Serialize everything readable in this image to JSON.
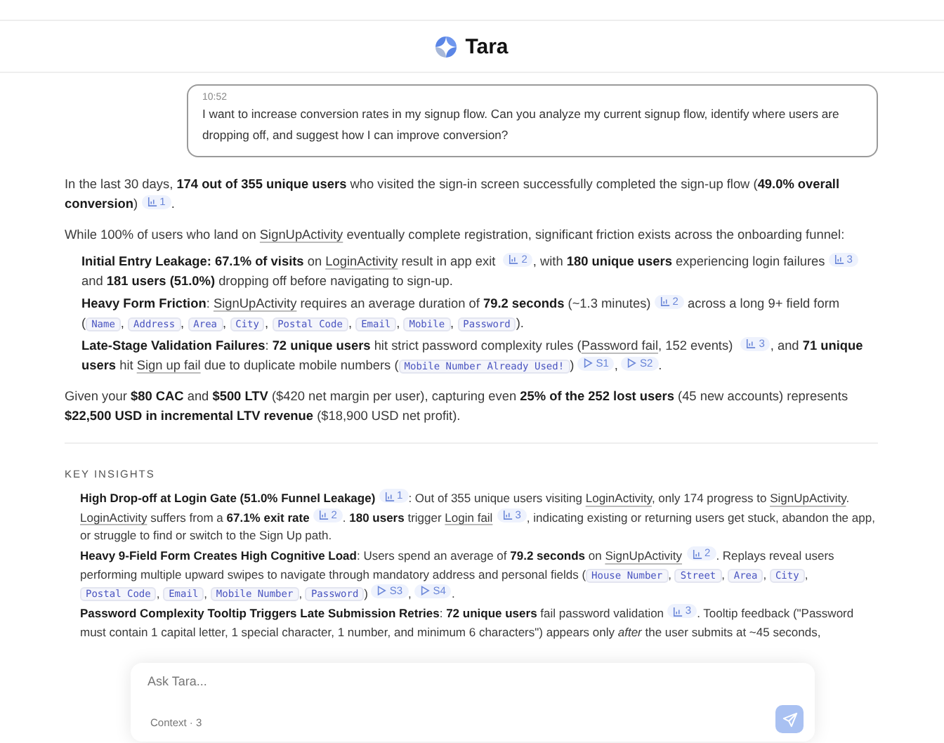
{
  "header": {
    "title": "Tara"
  },
  "user_message": {
    "time": "10:52",
    "text": "I want to increase conversion rates in my signup flow. Can you analyze my current signup flow, identify where users are dropping off, and suggest how I can improve conversion?"
  },
  "response": {
    "blocks": [
      {
        "kind": "paragraph",
        "segments": [
          {
            "kind": "text",
            "text": "In the last 30 days, **174 out of 355 unique users** who visited the sign-in screen successfully completed the sign-up flow (**49.0% overall conversion**) "
          },
          {
            "kind": "chart",
            "text": "1"
          },
          {
            "kind": "text",
            "text": "."
          }
        ]
      },
      {
        "kind": "paragraph",
        "segments": [
          {
            "kind": "text",
            "text": "While 100% of users who land on "
          },
          {
            "kind": "link",
            "text": "SignUpActivity"
          },
          {
            "kind": "text",
            "text": " eventually complete registration, significant friction exists across the onboarding funnel:"
          }
        ]
      },
      {
        "kind": "bullet",
        "segments": [
          {
            "kind": "text",
            "text": "**Initial Entry Leakage: 67.1% of visits** on "
          },
          {
            "kind": "link",
            "text": "LoginActivity"
          },
          {
            "kind": "text",
            "text": " result in app exit "
          },
          {
            "kind": "chart",
            "text": "2"
          },
          {
            "kind": "text",
            "text": ", with **180 unique users** experiencing login failures "
          },
          {
            "kind": "chart",
            "text": "3"
          },
          {
            "kind": "text",
            "text": " and **181 users (51.0%)** dropping off before navigating to sign-up."
          }
        ]
      },
      {
        "kind": "bullet",
        "segments": [
          {
            "kind": "text",
            "text": "**Heavy Form Friction**: "
          },
          {
            "kind": "link",
            "text": "SignUpActivity"
          },
          {
            "kind": "text",
            "text": " requires an average duration of **79.2 seconds** (~1.3 minutes) "
          },
          {
            "kind": "chart",
            "text": "2"
          },
          {
            "kind": "text",
            "text": " across a long 9+ field form ("
          },
          {
            "kind": "code",
            "text": "Name"
          },
          {
            "kind": "text",
            "text": ", "
          },
          {
            "kind": "code",
            "text": "Address"
          },
          {
            "kind": "text",
            "text": ", "
          },
          {
            "kind": "code",
            "text": "Area"
          },
          {
            "kind": "text",
            "text": ", "
          },
          {
            "kind": "code",
            "text": "City"
          },
          {
            "kind": "text",
            "text": ", "
          },
          {
            "kind": "code",
            "text": "Postal Code"
          },
          {
            "kind": "text",
            "text": ", "
          },
          {
            "kind": "code",
            "text": "Email"
          },
          {
            "kind": "text",
            "text": ", "
          },
          {
            "kind": "code",
            "text": "Mobile"
          },
          {
            "kind": "text",
            "text": ", "
          },
          {
            "kind": "code",
            "text": "Password"
          },
          {
            "kind": "text",
            "text": ")."
          }
        ]
      },
      {
        "kind": "bullet",
        "segments": [
          {
            "kind": "text",
            "text": "**Late-Stage Validation Failures**: **72 unique users** hit strict password complexity rules ("
          },
          {
            "kind": "link",
            "text": "Password fail"
          },
          {
            "kind": "text",
            "text": ", 152 events) "
          },
          {
            "kind": "chart",
            "text": "3"
          },
          {
            "kind": "text",
            "text": ", and **71 unique users** hit "
          },
          {
            "kind": "link",
            "text": "Sign up fail"
          },
          {
            "kind": "text",
            "text": " due to duplicate mobile numbers ("
          },
          {
            "kind": "code",
            "text": "Mobile Number Already Used!"
          },
          {
            "kind": "text",
            "text": ") "
          },
          {
            "kind": "session",
            "text": "S1"
          },
          {
            "kind": "text",
            "text": ", "
          },
          {
            "kind": "session",
            "text": "S2"
          },
          {
            "kind": "text",
            "text": "."
          }
        ]
      },
      {
        "kind": "paragraph",
        "segments": [
          {
            "kind": "text",
            "text": "Given your **$80 CAC** and **$500 LTV** ($420 net margin per user), capturing even **25% of the 252 lost users** (45 new accounts) represents **$22,500 USD in incremental LTV revenue** ($18,900 USD net profit)."
          }
        ]
      }
    ],
    "insights_heading": "KEY INSIGHTS",
    "insights": [
      {
        "segments": [
          {
            "kind": "text",
            "text": "**High Drop-off at Login Gate (51.0% Funnel Leakage)** "
          },
          {
            "kind": "chart",
            "text": "1"
          },
          {
            "kind": "text",
            "text": ": Out of 355 unique users visiting "
          },
          {
            "kind": "link",
            "text": "LoginActivity"
          },
          {
            "kind": "text",
            "text": ", only 174 progress to "
          },
          {
            "kind": "link",
            "text": "SignUpActivity"
          },
          {
            "kind": "text",
            "text": ". "
          },
          {
            "kind": "link",
            "text": "LoginActivity"
          },
          {
            "kind": "text",
            "text": " suffers from a **67.1% exit rate** "
          },
          {
            "kind": "chart",
            "text": "2"
          },
          {
            "kind": "text",
            "text": ". **180 users** trigger "
          },
          {
            "kind": "link",
            "text": "Login fail"
          },
          {
            "kind": "chart",
            "text": "3"
          },
          {
            "kind": "text",
            "text": ", indicating existing or returning users get stuck, abandon the app, or struggle to find or switch to the Sign Up path."
          }
        ]
      },
      {
        "segments": [
          {
            "kind": "text",
            "text": "**Heavy 9-Field Form Creates High Cognitive Load**: Users spend an average of **79.2 seconds** on "
          },
          {
            "kind": "link",
            "text": "SignUpActivity"
          },
          {
            "kind": "chart",
            "text": "2"
          },
          {
            "kind": "text",
            "text": ". Replays reveal users performing multiple upward swipes to navigate through mandatory address and personal fields ("
          },
          {
            "kind": "code",
            "text": "House Number"
          },
          {
            "kind": "text",
            "text": ", "
          },
          {
            "kind": "code",
            "text": "Street"
          },
          {
            "kind": "text",
            "text": ", "
          },
          {
            "kind": "code",
            "text": "Area"
          },
          {
            "kind": "text",
            "text": ", "
          },
          {
            "kind": "code",
            "text": "City"
          },
          {
            "kind": "text",
            "text": ", "
          },
          {
            "kind": "code",
            "text": "Postal Code"
          },
          {
            "kind": "text",
            "text": ", "
          },
          {
            "kind": "code",
            "text": "Email"
          },
          {
            "kind": "text",
            "text": ", "
          },
          {
            "kind": "code",
            "text": "Mobile Number"
          },
          {
            "kind": "text",
            "text": ", "
          },
          {
            "kind": "code",
            "text": "Password"
          },
          {
            "kind": "text",
            "text": ") "
          },
          {
            "kind": "session",
            "text": "S3"
          },
          {
            "kind": "text",
            "text": ", "
          },
          {
            "kind": "session",
            "text": "S4"
          },
          {
            "kind": "text",
            "text": "."
          }
        ]
      },
      {
        "segments": [
          {
            "kind": "text",
            "text": "**Password Complexity Tooltip Triggers Late Submission Retries**: **72 unique users** fail password validation "
          },
          {
            "kind": "chart",
            "text": "3"
          },
          {
            "kind": "text",
            "text": ". Tooltip feedback (\"Password must contain 1 capital letter, 1 special character, 1 number, and minimum 6 characters\") appears only *after* the user submits at ~45 seconds,"
          }
        ]
      }
    ]
  },
  "composer": {
    "placeholder": "Ask Tara...",
    "context": "Context · 3"
  }
}
